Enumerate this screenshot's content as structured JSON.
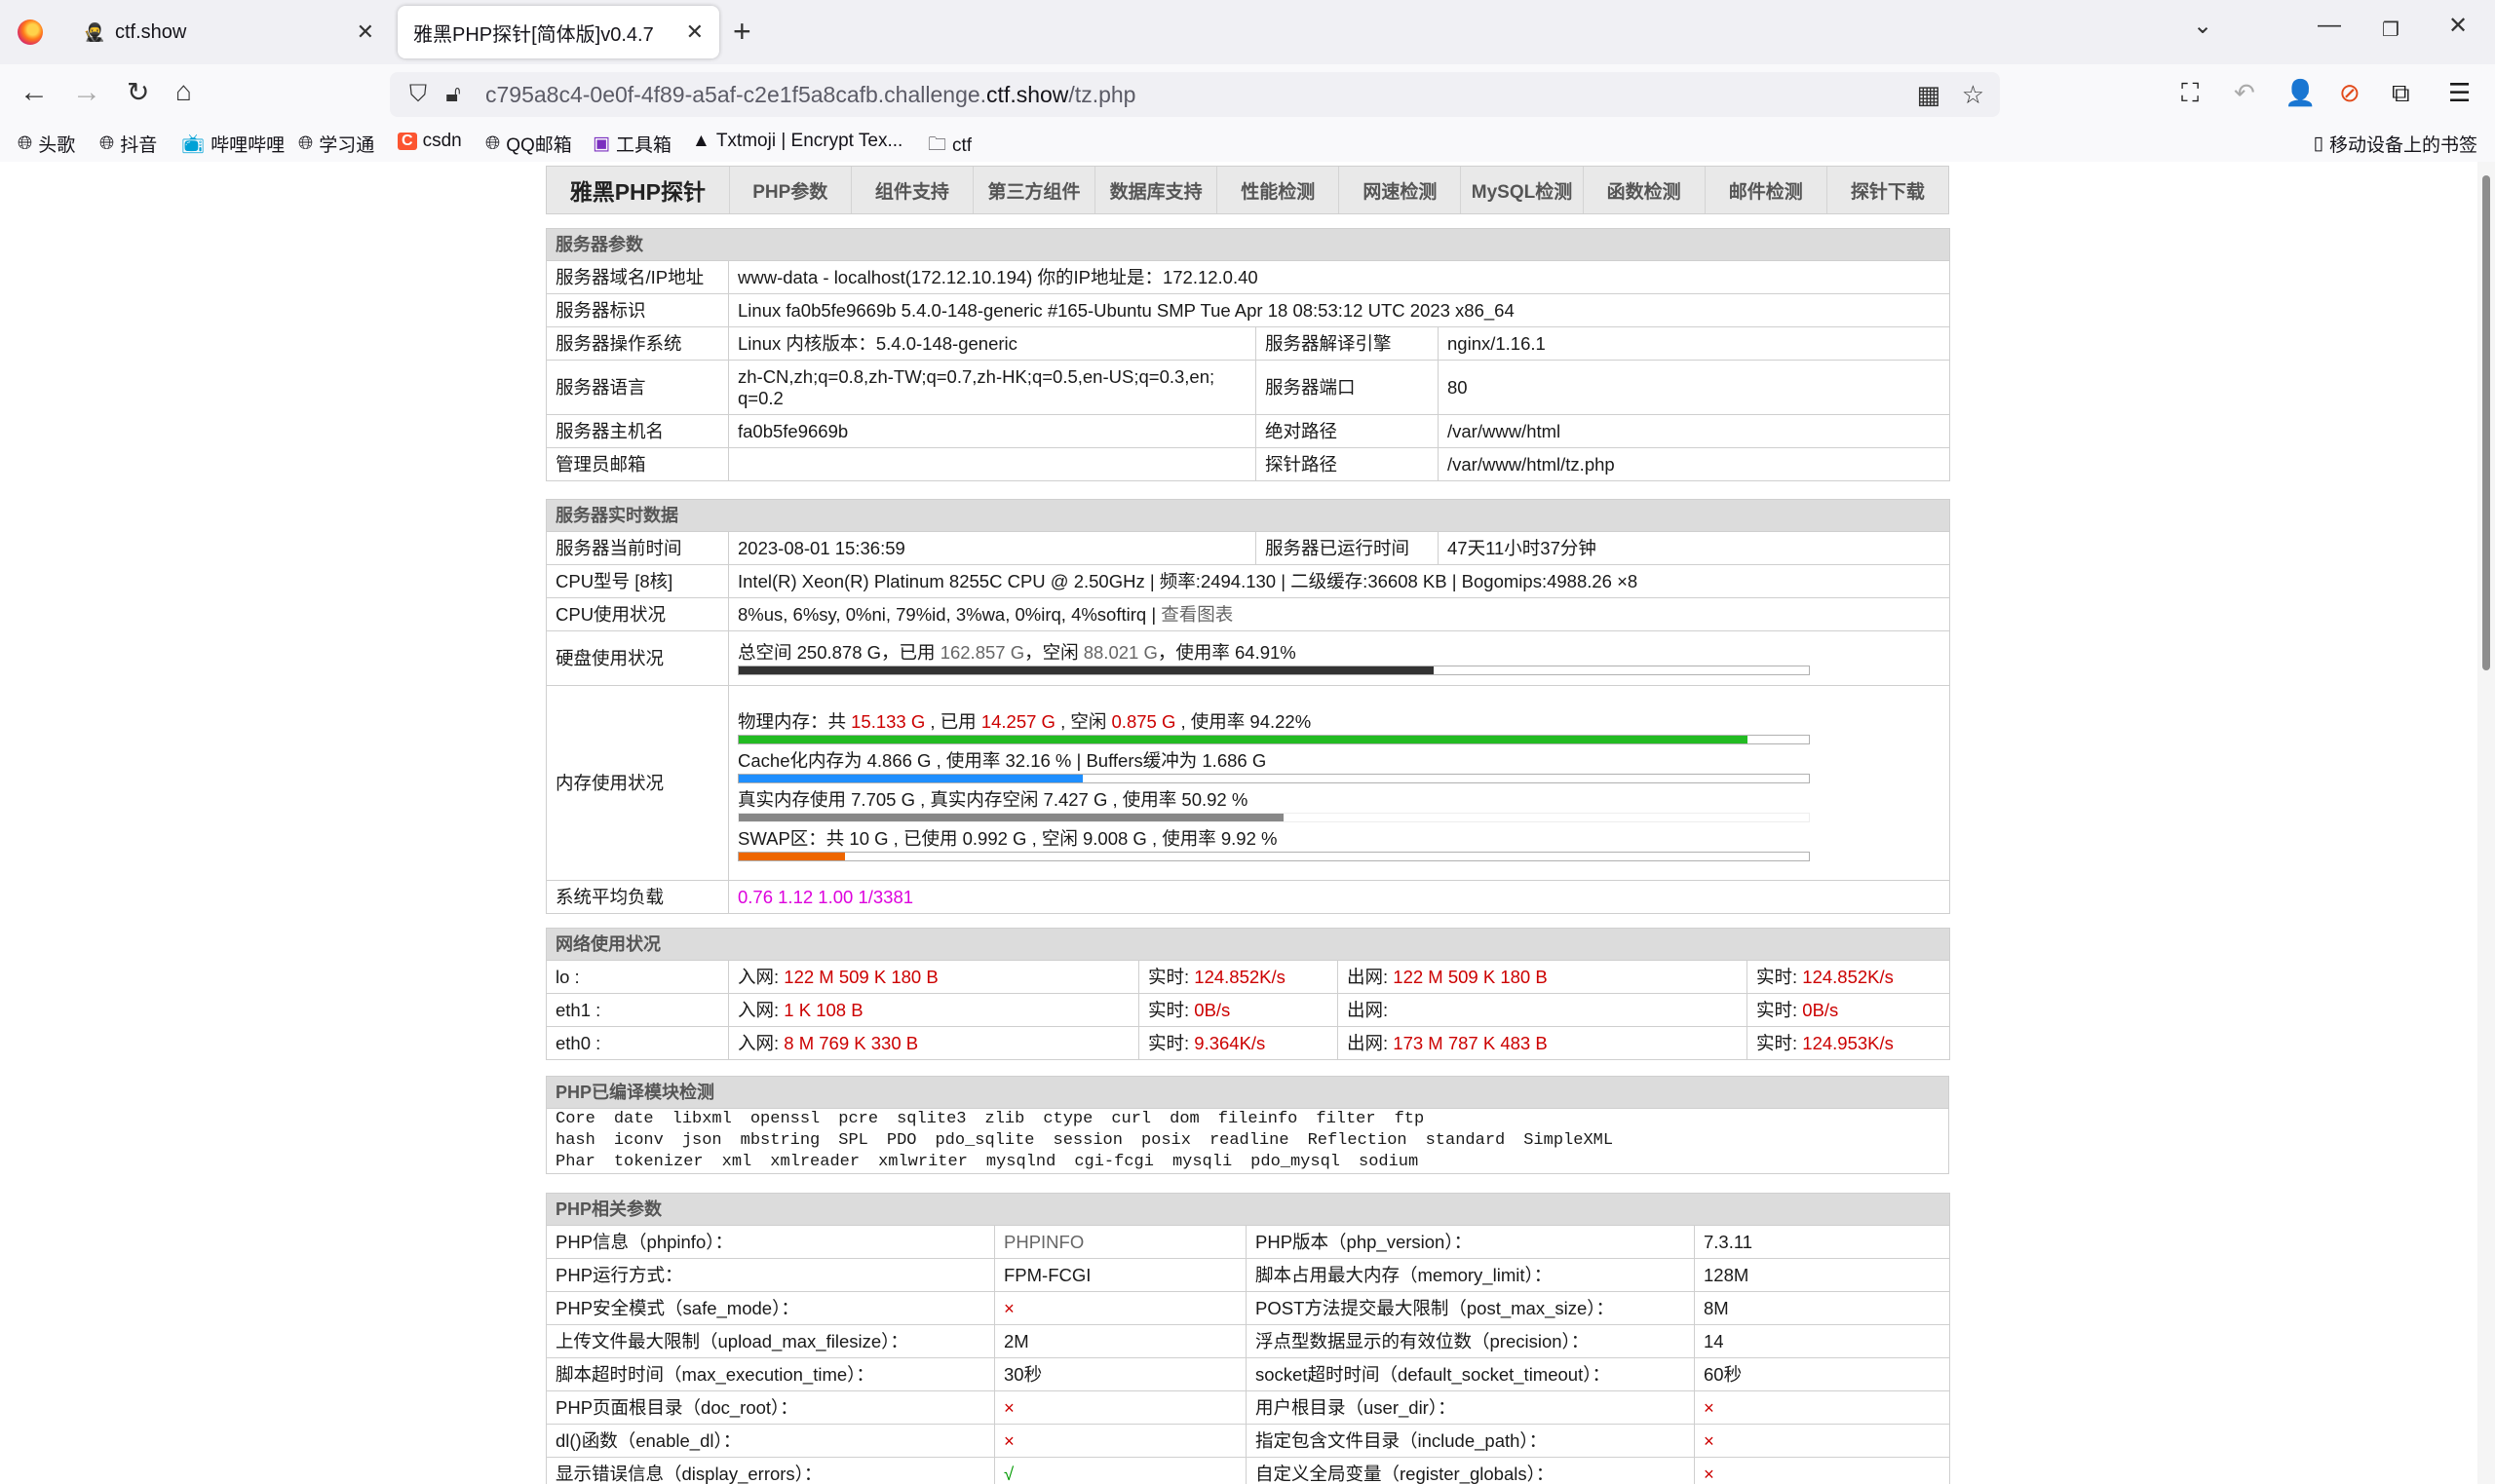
{
  "browser": {
    "tabs": [
      {
        "title": "ctf.show",
        "active": false
      },
      {
        "title": "雅黑PHP探针[简体版]v0.4.7",
        "active": true
      }
    ],
    "url_host_prefix": "c795a8c4-0e0f-4f89-a5af-c2e1f5a8cafb.challenge.",
    "url_host_domain": "ctf.show",
    "url_path": "/tz.php",
    "bookmarks": [
      "头歌",
      "抖音",
      "哔哩哔哩",
      "学习通",
      "csdn",
      "QQ邮箱",
      "工具箱",
      "Txtmoji | Encrypt Tex...",
      "ctf"
    ],
    "mobile_bookmarks": "移动设备上的书签"
  },
  "menu": {
    "brand": "雅黑PHP探针",
    "items": [
      "PHP参数",
      "组件支持",
      "第三方组件",
      "数据库支持",
      "性能检测",
      "网速检测",
      "MySQL检测",
      "函数检测",
      "邮件检测",
      "探针下载"
    ]
  },
  "server_params": {
    "header": "服务器参数",
    "domain_ip_label": "服务器域名/IP地址",
    "domain_ip_value": "www-data - localhost(172.12.10.194)  你的IP地址是：172.12.0.40",
    "ident_label": "服务器标识",
    "ident_value": "Linux fa0b5fe9669b 5.4.0-148-generic #165-Ubuntu SMP Tue Apr 18 08:53:12 UTC 2023 x86_64",
    "os_label": "服务器操作系统",
    "os_value": "Linux  内核版本：5.4.0-148-generic",
    "engine_label": "服务器解译引擎",
    "engine_value": "nginx/1.16.1",
    "lang_label": "服务器语言",
    "lang_value_1": "zh-CN,zh;q=0.8,zh-TW;q=0.7,zh-HK;q=0.5,en-US;q=0.3,en;",
    "lang_value_2": "q=0.2",
    "port_label": "服务器端口",
    "port_value": "80",
    "host_label": "服务器主机名",
    "host_value": "fa0b5fe9669b",
    "abspath_label": "绝对路径",
    "abspath_value": "/var/www/html",
    "admin_label": "管理员邮箱",
    "admin_value": "",
    "probepath_label": "探针路径",
    "probepath_value": "/var/www/html/tz.php"
  },
  "realtime": {
    "header": "服务器实时数据",
    "time_label": "服务器当前时间",
    "time_value": "2023-08-01 15:36:59",
    "uptime_label": "服务器已运行时间",
    "uptime_value": "47天11小时37分钟",
    "cpu_label": "CPU型号 [8核]",
    "cpu_value": "Intel(R) Xeon(R) Platinum 8255C CPU @ 2.50GHz | 频率:2494.130 | 二级缓存:36608 KB | Bogomips:4988.26 ×8",
    "cpuuse_label": "CPU使用状况",
    "cpuuse_value": "8%us, 6%sy, 0%ni, 79%id, 3%wa, 0%irq, 4%softirq | ",
    "cpuuse_link": "查看图表",
    "disk_label": "硬盘使用状况",
    "disk_prefix": "总空间 250.878 G，已用 ",
    "disk_used": "162.857 G",
    "disk_mid": "，空闲 ",
    "disk_free": "88.021 G",
    "disk_suffix": "，使用率 64.91%",
    "disk_fraction": 0.6491,
    "mem_label": "内存使用状况",
    "mem_phys_a": "物理内存：共 ",
    "mem_phys_total": "15.133 G",
    "mem_phys_b": " , 已用 ",
    "mem_phys_used": "14.257 G",
    "mem_phys_c": " , 空闲 ",
    "mem_phys_free": "0.875 G",
    "mem_phys_d": " , 使用率 94.22%",
    "mem_phys_fraction": 0.9422,
    "mem_cache_text": "Cache化内存为 4.866 G , 使用率 32.16 % | Buffers缓冲为 1.686 G",
    "mem_cache_fraction": 0.3216,
    "mem_real_text": "真实内存使用 7.705 G , 真实内存空闲 7.427 G , 使用率 50.92 %",
    "mem_real_fraction": 0.5092,
    "mem_swap_text": "SWAP区：共 10 G , 已使用 0.992 G , 空闲 9.008 G , 使用率 9.92 %",
    "mem_swap_fraction": 0.0992,
    "load_label": "系统平均负载",
    "load_value": "0.76 1.12 1.00 1/3381"
  },
  "network": {
    "header": "网络使用状况",
    "rows": [
      {
        "iface": "lo :",
        "in": "122 M 509 K 180 B",
        "in_rt": "124.852K/s",
        "out": "122 M 509 K 180 B",
        "out_rt": "124.852K/s"
      },
      {
        "iface": "eth1 :",
        "in": "1 K 108 B",
        "in_rt": "0B/s",
        "out": "",
        "out_rt": "0B/s"
      },
      {
        "iface": "eth0 :",
        "in": "8 M 769 K 330 B",
        "in_rt": "9.364K/s",
        "out": "173 M 787 K 483 B",
        "out_rt": "124.953K/s"
      }
    ],
    "in_label": "入网: ",
    "rt_label": "实时: ",
    "out_label": "出网: "
  },
  "modules": {
    "header": "PHP已编译模块检测",
    "line1": [
      "Core",
      "date",
      "libxml",
      "openssl",
      "pcre",
      "sqlite3",
      "zlib",
      "ctype",
      "curl",
      "dom",
      "fileinfo",
      "filter",
      "ftp"
    ],
    "line2": [
      "hash",
      "iconv",
      "json",
      "mbstring",
      "SPL",
      "PDO",
      "pdo_sqlite",
      "session",
      "posix",
      "readline",
      "Reflection",
      "standard",
      "SimpleXML"
    ],
    "line3": [
      "Phar",
      "tokenizer",
      "xml",
      "xmlreader",
      "xmlwriter",
      "mysqlnd",
      "cgi-fcgi",
      "mysqli",
      "pdo_mysql",
      "sodium"
    ]
  },
  "php_params": {
    "header": "PHP相关参数",
    "rows": [
      {
        "l1": "PHP信息（phpinfo）：",
        "v1": "PHPINFO",
        "v1c": "gray",
        "l2": "PHP版本（php_version）：",
        "v2": "7.3.11",
        "v2c": ""
      },
      {
        "l1": "PHP运行方式：",
        "v1": "FPM-FCGI",
        "v1c": "",
        "l2": "脚本占用最大内存（memory_limit）：",
        "v2": "128M",
        "v2c": ""
      },
      {
        "l1": "PHP安全模式（safe_mode）：",
        "v1": "×",
        "v1c": "red",
        "l2": "POST方法提交最大限制（post_max_size）：",
        "v2": "8M",
        "v2c": ""
      },
      {
        "l1": "上传文件最大限制（upload_max_filesize）：",
        "v1": "2M",
        "v1c": "",
        "l2": "浮点型数据显示的有效位数（precision）：",
        "v2": "14",
        "v2c": ""
      },
      {
        "l1": "脚本超时时间（max_execution_time）：",
        "v1": "30秒",
        "v1c": "",
        "l2": "socket超时时间（default_socket_timeout）：",
        "v2": "60秒",
        "v2c": ""
      },
      {
        "l1": "PHP页面根目录（doc_root）：",
        "v1": "×",
        "v1c": "red",
        "l2": "用户根目录（user_dir）：",
        "v2": "×",
        "v2c": "red"
      },
      {
        "l1": "dl()函数（enable_dl）：",
        "v1": "×",
        "v1c": "red",
        "l2": "指定包含文件目录（include_path）：",
        "v2": "×",
        "v2c": "red"
      },
      {
        "l1": "显示错误信息（display_errors）：",
        "v1": "√",
        "v1c": "green",
        "l2": "自定义全局变量（register_globals）：",
        "v2": "×",
        "v2c": "red"
      }
    ]
  },
  "colors": {
    "bar_disk": "#333333",
    "bar_phys": "#22bb22",
    "bar_cache": "#1f8fff",
    "bar_real": "#888888",
    "bar_swap": "#ee6600"
  }
}
